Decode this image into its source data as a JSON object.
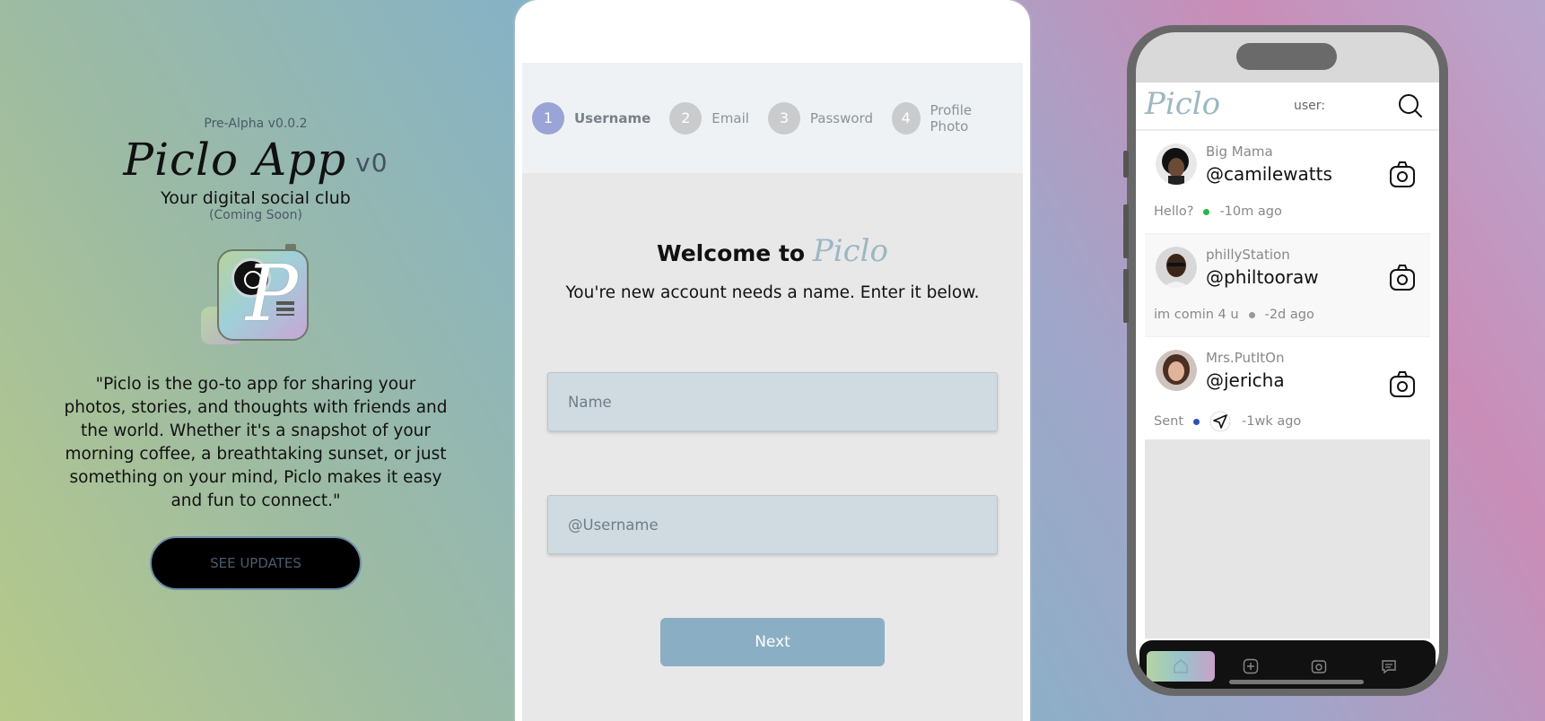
{
  "hero": {
    "version": "Pre-Alpha v0.0.2",
    "title": "Piclo App",
    "title_version": "v0",
    "tagline": "Your digital social club",
    "coming_soon": "(Coming Soon)",
    "quote": "\"Piclo is the go-to app for sharing your photos, stories, and thoughts with friends and the world. Whether it's a snapshot of your morning coffee, a breathtaking sunset, or just something on your mind, Piclo makes it easy and fun to connect.\"",
    "updates_button": "SEE UPDATES"
  },
  "signup": {
    "steps": [
      {
        "num": "1",
        "label": "Username",
        "active": true
      },
      {
        "num": "2",
        "label": "Email",
        "active": false
      },
      {
        "num": "3",
        "label": "Password",
        "active": false
      },
      {
        "num": "4",
        "label": "Profile Photo",
        "active": false
      }
    ],
    "welcome": "Welcome to",
    "brand": "Piclo",
    "subtext": "You're new account needs a name. Enter it below.",
    "name_placeholder": "Name",
    "username_placeholder": "@Username",
    "next_button": "Next"
  },
  "device": {
    "brand": "Piclo",
    "user_label": "user:",
    "feed": [
      {
        "display_name": "Big Mama",
        "handle": "@camilewatts",
        "status": "Hello?",
        "dot_color": "#2bb44a",
        "time": "-10m ago",
        "sent_icon": false
      },
      {
        "display_name": "phillyStation",
        "handle": "@philtooraw",
        "status": "im comin 4 u",
        "dot_color": "#999999",
        "time": "-2d ago",
        "sent_icon": false
      },
      {
        "display_name": "Mrs.PutItOn",
        "handle": "@jericha",
        "status": "Sent",
        "dot_color": "#2f4fb8",
        "time": "-1wk ago",
        "sent_icon": true
      }
    ],
    "nav": [
      "home-icon",
      "add-icon",
      "camera-icon",
      "messages-icon"
    ]
  },
  "colors": {
    "accent": "#8aafc4",
    "step_active": "#9aa4d6"
  }
}
